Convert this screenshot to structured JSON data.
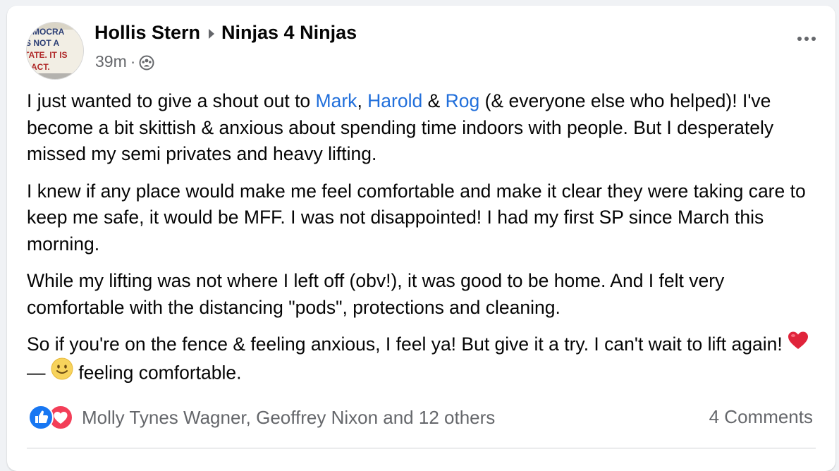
{
  "post": {
    "author": "Hollis Stern",
    "group": "Ninjas 4 Ninjas",
    "timestamp": "39m",
    "separator": "·",
    "avatar_text": {
      "line1": "MOCRA",
      "line2": "S NOT A",
      "line3": "TATE. IT IS",
      "line4": "ACT."
    },
    "paragraph1": {
      "t1": "I just wanted to give a shout out to ",
      "mention1": "Mark",
      "t2": ", ",
      "mention2": "Harold",
      "t3": " & ",
      "mention3": "Rog",
      "t4": " (& everyone else who helped)! I've become a bit skittish & anxious about spending time indoors with people. But I desperately missed my semi privates and heavy lifting."
    },
    "paragraph2": "I knew if any place would make me feel comfortable and make it clear they were taking care to keep me safe, it would be MFF. I was not disappointed! I had my first SP since March this morning.",
    "paragraph3": "While my lifting was not where I left off (obv!), it was good to be home. And I felt very comfortable with the distancing \"pods\", protections and cleaning.",
    "paragraph4": {
      "t1": "So if you're on the fence & feeling anxious, I feel ya! But give it a try. I can't wait to lift again! ",
      "dash": " — ",
      "feeling": " feeling comfortable."
    }
  },
  "footer": {
    "reactors": "Molly Tynes Wagner, Geoffrey Nixon and 12 others",
    "comments": "4 Comments"
  },
  "icons": {
    "like": "like-reaction-icon",
    "love": "love-reaction-icon",
    "heart": "red-heart-emoji",
    "feeling": "smiling-face-icon",
    "privacy": "group-icon",
    "more": "more-options-icon"
  },
  "colors": {
    "link": "#216fdb",
    "secondary_text": "#65676b",
    "like_blue": "#1877f2",
    "love_red": "#f33e58"
  }
}
